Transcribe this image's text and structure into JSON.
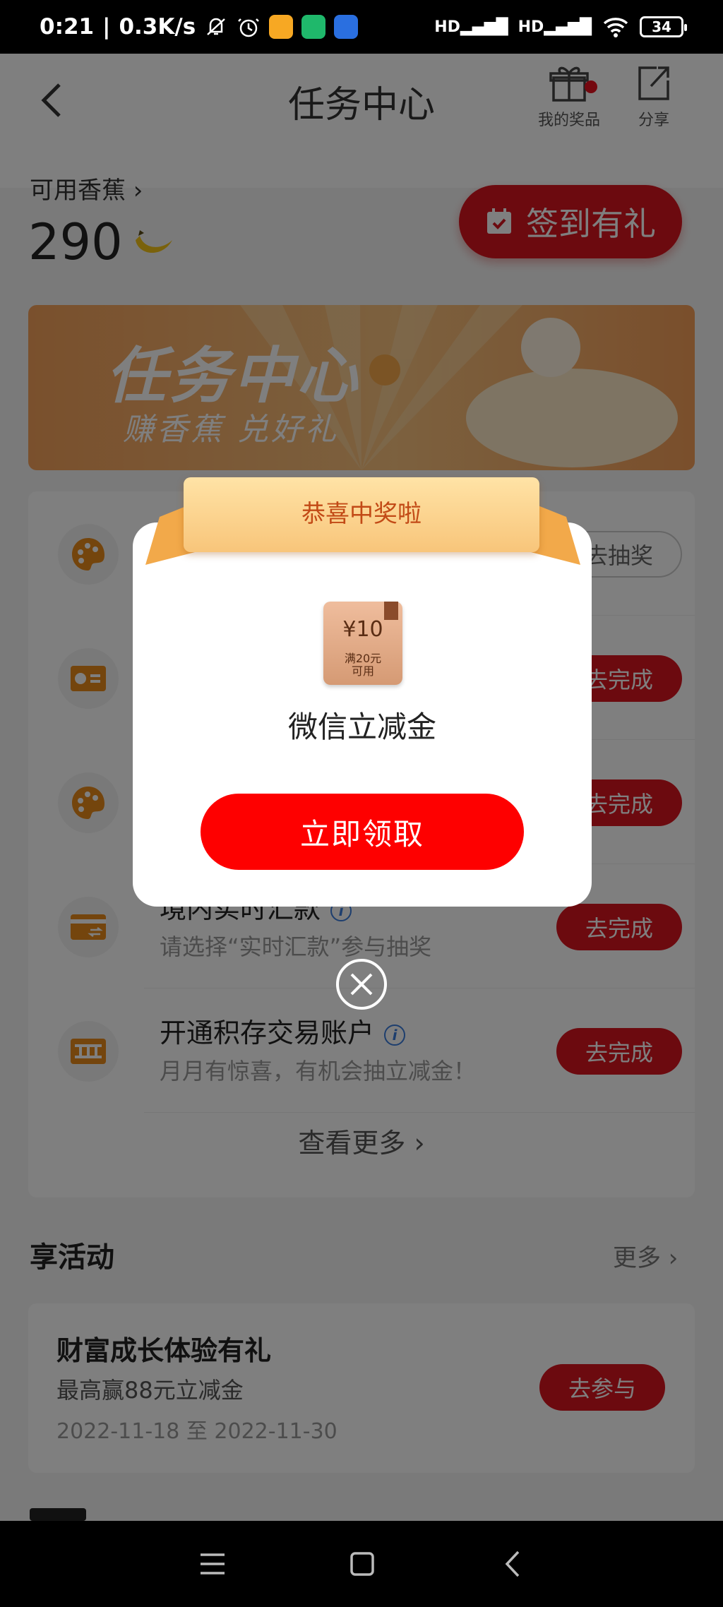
{
  "status_bar": {
    "time": "0:21",
    "net_speed": "0.3K/s",
    "signal_1": "HD",
    "signal_2": "HD",
    "battery": "34"
  },
  "header": {
    "title": "任务中心",
    "prizes_label": "我的奖品",
    "share_label": "分享"
  },
  "bananas": {
    "label": "可用香蕉",
    "count": "290"
  },
  "signin_label": "签到有礼",
  "banner": {
    "title": "任务中心",
    "subtitle": "赚香蕉 兑好礼"
  },
  "tasks": [
    {
      "name": "",
      "desc": "",
      "button": "去抽奖",
      "icon": "palette-icon"
    },
    {
      "name": "",
      "desc": "",
      "button": "去完成",
      "icon": "chart-card-icon"
    },
    {
      "name": "",
      "desc": "",
      "button": "去完成",
      "icon": "palette-icon"
    },
    {
      "name": "境内实时汇款",
      "desc": "请选择“实时汇款”参与抽奖",
      "button": "去完成",
      "icon": "card-transfer-icon"
    },
    {
      "name": "开通积存交易账户",
      "desc": "月月有惊喜，有机会抽立减金！",
      "button": "去完成",
      "icon": "gold-bar-icon"
    }
  ],
  "see_more": "查看更多",
  "activities": {
    "title": "享活动",
    "more": "更多",
    "item": {
      "name": "财富成长体验有礼",
      "desc": "最高赢88元立减金",
      "date": "2022-11-18 至 2022-11-30",
      "button": "去参与"
    }
  },
  "modal": {
    "ribbon": "恭喜中奖啦",
    "prize_amount": "¥10",
    "prize_condition_1": "满20元",
    "prize_condition_2": "可用",
    "prize_name": "微信立减金",
    "claim_button": "立即领取"
  },
  "colors": {
    "primary_red": "#d8141f",
    "claim_red": "#fe0000",
    "ribbon_gold": "#f8c57a",
    "ribbon_text": "#c24a16"
  }
}
